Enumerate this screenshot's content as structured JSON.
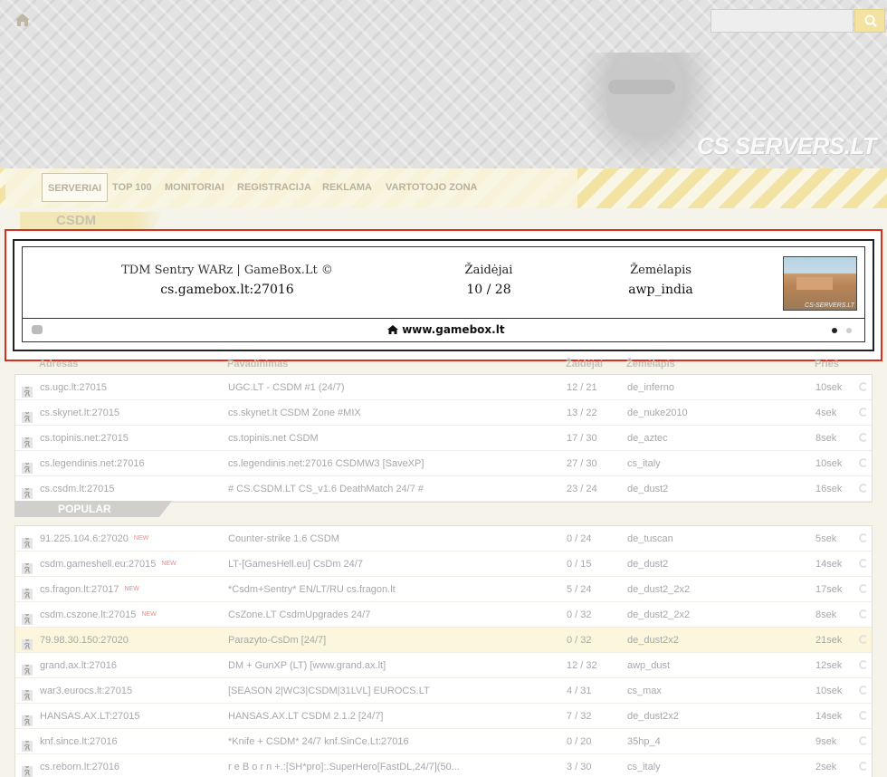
{
  "header": {
    "logo_text": "CS SERVERS.LT",
    "search_placeholder": ""
  },
  "nav": {
    "items": [
      {
        "label": "SERVERIAI",
        "active": true
      },
      {
        "label": "TOP 100",
        "active": false
      },
      {
        "label": "MONITORIAI",
        "active": false
      },
      {
        "label": "REGISTRACIJA",
        "active": false
      },
      {
        "label": "REKLAMA",
        "active": false
      },
      {
        "label": "VARTOTOJO ZONA",
        "active": false
      }
    ]
  },
  "section": {
    "title": "CSDM"
  },
  "featured": {
    "name": "TDM Sentry WARz | GameBox.Lt ©",
    "address": "cs.gamebox.lt:27016",
    "players_label": "Žaidėjai",
    "players_value": "10 / 28",
    "map_label": "Žemėlapis",
    "map_value": "awp_india",
    "map_thumb_caption": "CS-SERVERS.LT",
    "site": "www.gamebox.lt",
    "dots": [
      "active",
      "inactive"
    ]
  },
  "columns": {
    "address": "Adresas",
    "name": "Pavadinimas",
    "players": "Žaidėjai",
    "map": "Žemėlapis",
    "ago": "Prieš"
  },
  "csdm_servers": [
    {
      "address": "cs.ugc.lt:27015",
      "name": "UGC.LT - CSDM #1 (24/7)",
      "players": "12 / 21",
      "map": "de_inferno",
      "ago": "10sek"
    },
    {
      "address": "cs.skynet.lt:27015",
      "name": "cs.skynet.lt CSDM Zone #MIX",
      "players": "13 / 22",
      "map": "de_nuke2010",
      "ago": "4sek"
    },
    {
      "address": "cs.topinis.net:27015",
      "name": "cs.topinis.net CSDM",
      "players": "17 / 30",
      "map": "de_aztec",
      "ago": "8sek"
    },
    {
      "address": "cs.legendinis.net:27016",
      "name": "cs.legendinis.net:27016 CSDMW3 [SaveXP]",
      "players": "27 / 30",
      "map": "cs_italy",
      "ago": "10sek"
    },
    {
      "address": "cs.csdm.lt:27015",
      "name": "# CS.CSDM.LT CS_v1.6 DeathMatch 24/7 #",
      "players": "23 / 24",
      "map": "de_dust2",
      "ago": "16sek"
    }
  ],
  "popular": {
    "title": "POPULAR",
    "new_badge": "NEW",
    "servers": [
      {
        "address": "91.225.104.6:27020",
        "is_new": true,
        "name": "Counter-strike 1.6 CSDM",
        "players": "0 / 24",
        "map": "de_tuscan",
        "ago": "5sek"
      },
      {
        "address": "csdm.gameshell.eu:27015",
        "is_new": true,
        "name": "LT-[GamesHell.eu] CsDm 24/7",
        "players": "0 / 15",
        "map": "de_dust2",
        "ago": "14sek"
      },
      {
        "address": "cs.fragon.lt:27017",
        "is_new": true,
        "name": "*Csdm+Sentry* EN/LT/RU cs.fragon.lt",
        "players": "5 / 24",
        "map": "de_dust2_2x2",
        "ago": "17sek"
      },
      {
        "address": "csdm.cszone.lt:27015",
        "is_new": true,
        "name": "CsZone.LT CsdmUpgrades 24/7",
        "players": "0 / 32",
        "map": "de_dust2_2x2",
        "ago": "8sek"
      },
      {
        "address": "79.98.30.150:27020",
        "is_new": false,
        "name": "Parazyto-CsDm [24/7]",
        "players": "0 / 32",
        "map": "de_dust2x2",
        "ago": "21sek"
      },
      {
        "address": "grand.ax.lt:27016",
        "is_new": false,
        "name": "DM + GunXP (LT) [www.grand.ax.lt]",
        "players": "12 / 32",
        "map": "awp_dust",
        "ago": "12sek"
      },
      {
        "address": "war3.eurocs.lt:27015",
        "is_new": false,
        "name": "[SEASON 2|WC3|CSDM|31LVL] EUROCS.LT",
        "players": "4 / 31",
        "map": "cs_max",
        "ago": "10sek"
      },
      {
        "address": "HANSAS.AX.LT:27015",
        "is_new": false,
        "name": "HANSAS.AX.LT CSDM 2.1.2 [24/7]",
        "players": "7 / 32",
        "map": "de_dust2x2",
        "ago": "14sek"
      },
      {
        "address": "knf.since.lt:27016",
        "is_new": false,
        "name": "*Knife + CSDM* 24/7 knf.SinCe.Lt:27016",
        "players": "0 / 20",
        "map": "35hp_4",
        "ago": "9sek"
      },
      {
        "address": "cs.reborn.lt:27016",
        "is_new": false,
        "name": "r e B o r n +.:[SH*pro]:.SuperHero[FastDL,24/7](50...",
        "players": "3 / 30",
        "map": "cs_italy",
        "ago": "2sek"
      }
    ]
  },
  "colors": {
    "highlight_frame": "#d9301e",
    "nav_stripe": "#f3e3a2",
    "row_highlight": "#fcf6dd"
  }
}
